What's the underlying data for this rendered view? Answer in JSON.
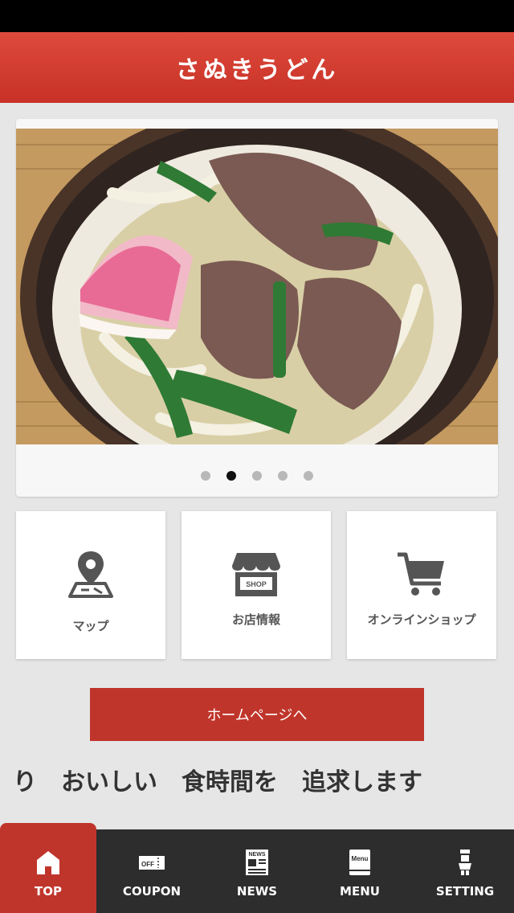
{
  "header": {
    "title": "さぬきうどん"
  },
  "carousel": {
    "slide_count": 5,
    "active_index": 1
  },
  "tiles": [
    {
      "label": "マップ",
      "icon": "map-pin-icon"
    },
    {
      "label": "お店情報",
      "icon": "shop-icon",
      "icon_text": "SHOP"
    },
    {
      "label": "オンラインショップ",
      "icon": "cart-icon"
    }
  ],
  "home_button": {
    "label": "ホームページへ"
  },
  "marquee": {
    "text": "り　おいしい　食時間を　追求します"
  },
  "tabbar": {
    "items": [
      {
        "label": "TOP",
        "icon": "home-icon",
        "active": true
      },
      {
        "label": "COUPON",
        "icon": "coupon-icon",
        "icon_text": "OFF"
      },
      {
        "label": "NEWS",
        "icon": "news-icon",
        "icon_text": "NEWS"
      },
      {
        "label": "MENU",
        "icon": "menu-book-icon",
        "icon_text": "Menu"
      },
      {
        "label": "SETTING",
        "icon": "settings-icon"
      }
    ]
  },
  "colors": {
    "brand_red": "#c0352b",
    "tabbar_bg": "#2d2d2d"
  }
}
